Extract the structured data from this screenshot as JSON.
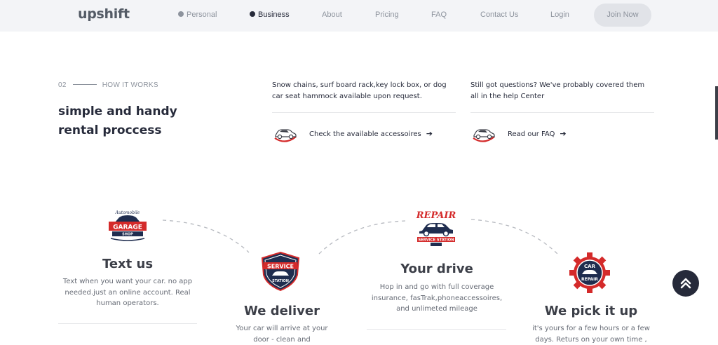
{
  "header": {
    "logo": "upshift",
    "nav": {
      "personal": "Personal",
      "business": "Business",
      "about": "About",
      "pricing": "Pricing",
      "faq": "FAQ",
      "contact": "Contact Us",
      "login": "Login"
    },
    "join_label": "Join Now"
  },
  "how_it_works": {
    "step_number": "02",
    "step_label": "HOW IT WORKS",
    "title": "simple and handy rental proccess",
    "accessories": {
      "text": "Snow chains, surf board rack,key lock box, or dog car seat hammock available upon request.",
      "link_label": "Check the available accessoires",
      "icon": "car-icon"
    },
    "faq": {
      "text": "Still got questions? We've probably covered them all in the help Center",
      "link_label": "Read our FAQ",
      "icon": "car-icon"
    }
  },
  "steps": [
    {
      "title": "Text us",
      "description": "Text when you want your car. no app needed.just an online account. Real human operators.",
      "badge_text": [
        "Automobile",
        "GARAGE",
        "SHOP"
      ]
    },
    {
      "title": "We deliver",
      "description": "Your car will arrive at your door - clean and",
      "badge_text": [
        "SERVICE",
        "STATION"
      ]
    },
    {
      "title": "Your drive",
      "description": "Hop in and go with full coverage insurance, fasTrak,phoneaccessoires, and unlimeted mileage",
      "badge_text": [
        "REPAIR",
        "SERVICE STATION"
      ]
    },
    {
      "title": "We pick it up",
      "description": "it's yours for a few hours or a few days. Returs on your own time ,",
      "badge_text": [
        "CAR",
        "REPAIR"
      ]
    }
  ],
  "colors": {
    "primary": "#262a3a",
    "muted": "#8d939d",
    "accent_red": "#d42a2a",
    "badge_navy": "#1f2d4f"
  }
}
